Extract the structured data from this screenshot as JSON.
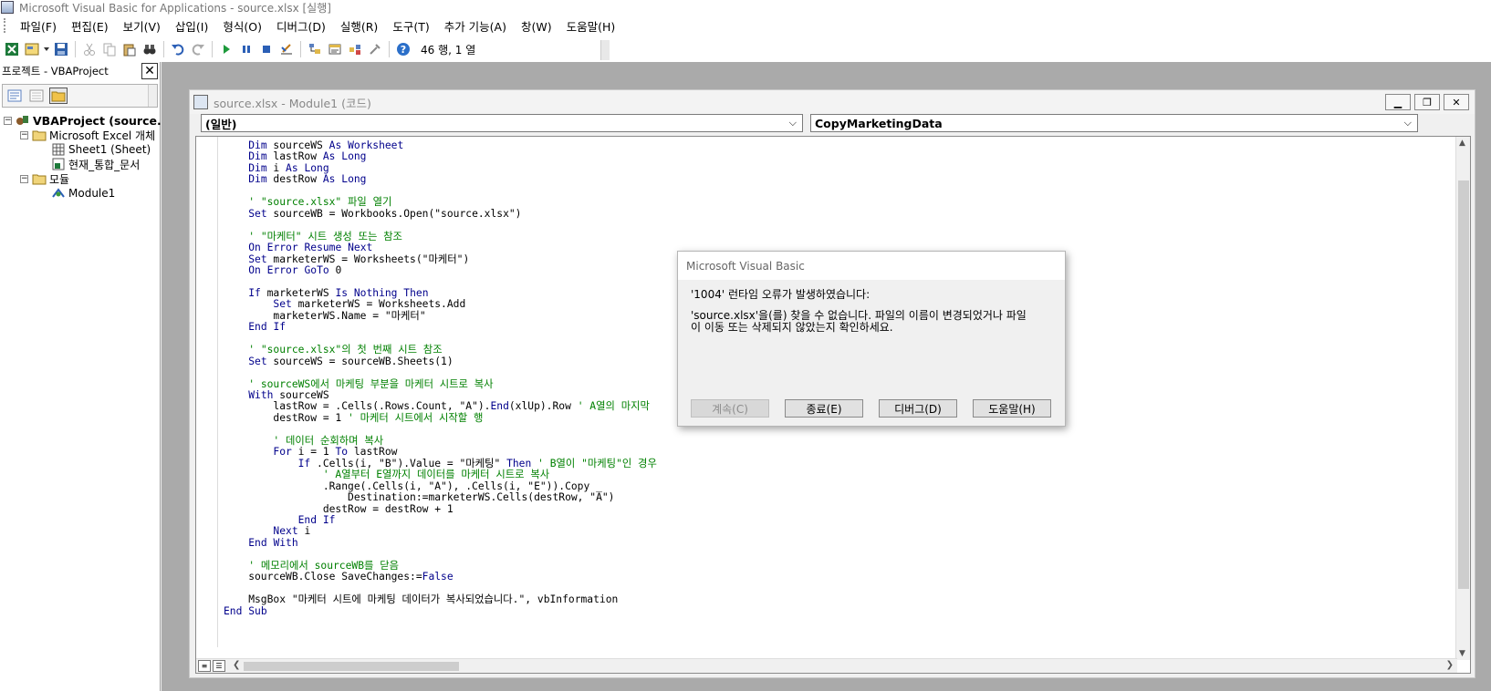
{
  "window": {
    "title": "Microsoft Visual Basic for Applications - source.xlsx [실행]"
  },
  "menu": [
    "파일(F)",
    "편집(E)",
    "보기(V)",
    "삽입(I)",
    "형식(O)",
    "디버그(D)",
    "실행(R)",
    "도구(T)",
    "추가 기능(A)",
    "창(W)",
    "도움말(H)"
  ],
  "toolbar": {
    "status": "46 행, 1 열"
  },
  "project": {
    "title": "프로젝트 - VBAProject",
    "tree": {
      "root": "VBAProject (source.",
      "excel_objects": "Microsoft Excel 개체",
      "sheet1": "Sheet1 (Sheet)",
      "thisworkbook": "현재_통합_문서",
      "modules": "모듈",
      "module1": "Module1"
    }
  },
  "codewin": {
    "title": "source.xlsx - Module1 (코드)",
    "object_combo": "(일반)",
    "proc_combo": "CopyMarketingData",
    "lines": [
      "    Dim sourceWS As Worksheet",
      "    Dim lastRow As Long",
      "    Dim i As Long",
      "    Dim destRow As Long",
      "",
      "    ' \"source.xlsx\" 파일 열기",
      "    Set sourceWB = Workbooks.Open(\"source.xlsx\")",
      "",
      "    ' \"마케터\" 시트 생성 또는 참조",
      "    On Error Resume Next",
      "    Set marketerWS = Worksheets(\"마케터\")",
      "    On Error GoTo 0",
      "",
      "    If marketerWS Is Nothing Then",
      "        Set marketerWS = Worksheets.Add",
      "        marketerWS.Name = \"마케터\"",
      "    End If",
      "",
      "    ' \"source.xlsx\"의 첫 번째 시트 참조",
      "    Set sourceWS = sourceWB.Sheets(1)",
      "",
      "    ' sourceWS에서 마케팅 부분을 마케터 시트로 복사",
      "    With sourceWS",
      "        lastRow = .Cells(.Rows.Count, \"A\").End(xlUp).Row ' A열의 마지막",
      "        destRow = 1 ' 마케터 시트에서 시작할 행",
      "",
      "        ' 데이터 순회하며 복사",
      "        For i = 1 To lastRow",
      "            If .Cells(i, \"B\").Value = \"마케팅\" Then ' B열이 \"마케팅\"인 경우",
      "                ' A열부터 E열까지 데이터를 마케터 시트로 복사",
      "                .Range(.Cells(i, \"A\"), .Cells(i, \"E\")).Copy _",
      "                    Destination:=marketerWS.Cells(destRow, \"A\")",
      "                destRow = destRow + 1",
      "            End If",
      "        Next i",
      "    End With",
      "",
      "    ' 메모리에서 sourceWB를 닫음",
      "    sourceWB.Close SaveChanges:=False",
      "",
      "    MsgBox \"마케터 시트에 마케팅 데이터가 복사되었습니다.\", vbInformation",
      "End Sub"
    ]
  },
  "dialog": {
    "title": "Microsoft Visual Basic",
    "error": "'1004' 런타임 오류가 발생하였습니다:",
    "message_line1": "'source.xlsx'을(를) 찾을 수 없습니다. 파일의 이름이 변경되었거나 파일",
    "message_line2": "이 이동 또는 삭제되지 않았는지 확인하세요.",
    "buttons": {
      "continue": "계속(C)",
      "end": "종료(E)",
      "debug": "디버그(D)",
      "help": "도움말(H)"
    }
  },
  "colors": {
    "keyword": "#00008b",
    "comment": "#008000",
    "mdi_background": "#aaaaaa"
  }
}
